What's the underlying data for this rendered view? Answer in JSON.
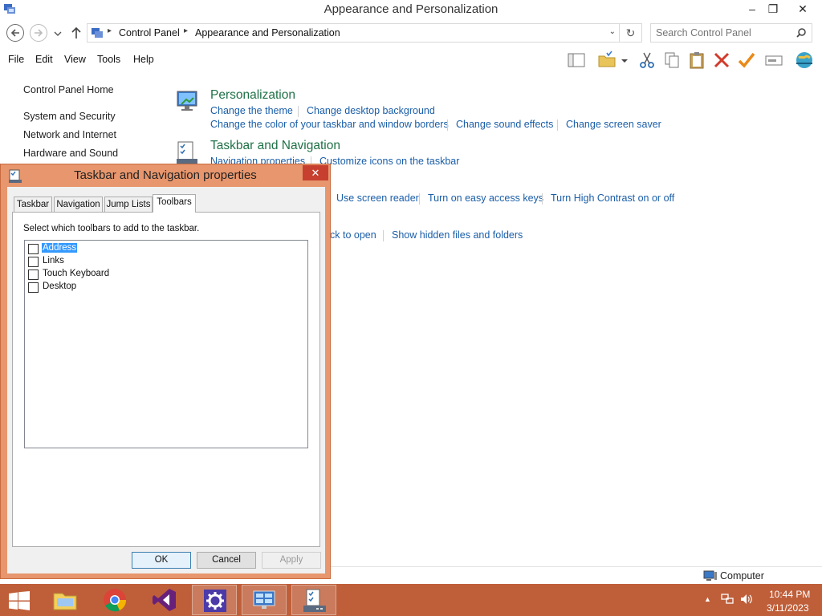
{
  "window": {
    "title": "Appearance and Personalization"
  },
  "address": {
    "crumbs": [
      "Control Panel",
      "Appearance and Personalization"
    ],
    "search_placeholder": "Search Control Panel"
  },
  "menu": [
    "File",
    "Edit",
    "View",
    "Tools",
    "Help"
  ],
  "left_pane": [
    "Control Panel Home",
    "System and Security",
    "Network and Internet",
    "Hardware and Sound"
  ],
  "categories": [
    {
      "title": "Personalization",
      "links": [
        "Change the theme",
        "Change desktop background",
        "Change the color of your taskbar and window borders",
        "Change sound effects",
        "Change screen saver"
      ]
    },
    {
      "title": "Taskbar and Navigation",
      "links": [
        "Navigation properties",
        "Customize icons on the taskbar"
      ]
    }
  ],
  "partial_links": {
    "row1": [
      "Use screen reader",
      "Turn on easy access keys",
      "Turn High Contrast on or off"
    ],
    "row2": [
      "ck to open",
      "Show hidden files and folders"
    ]
  },
  "status": {
    "text": "Computer"
  },
  "dialog": {
    "title": "Taskbar and Navigation properties",
    "tabs": [
      "Taskbar",
      "Navigation",
      "Jump Lists",
      "Toolbars"
    ],
    "active_tab": "Toolbars",
    "instruction": "Select which toolbars to add to the taskbar.",
    "toolbars": [
      {
        "label": "Address",
        "checked": false,
        "selected": true
      },
      {
        "label": "Links",
        "checked": false,
        "selected": false
      },
      {
        "label": "Touch Keyboard",
        "checked": false,
        "selected": false
      },
      {
        "label": "Desktop",
        "checked": false,
        "selected": false
      }
    ],
    "buttons": {
      "ok": "OK",
      "cancel": "Cancel",
      "apply": "Apply"
    }
  },
  "taskbar": {
    "apps": [
      "file-explorer",
      "chrome",
      "visual-studio",
      "settings",
      "control-panel",
      "taskbar-properties"
    ],
    "time": "10:44 PM",
    "date": "3/11/2023"
  },
  "colors": {
    "accent": "#bf5f3a",
    "dialog_frame": "#e7966d",
    "link": "#1a5ea8",
    "category_title": "#1e7145"
  }
}
